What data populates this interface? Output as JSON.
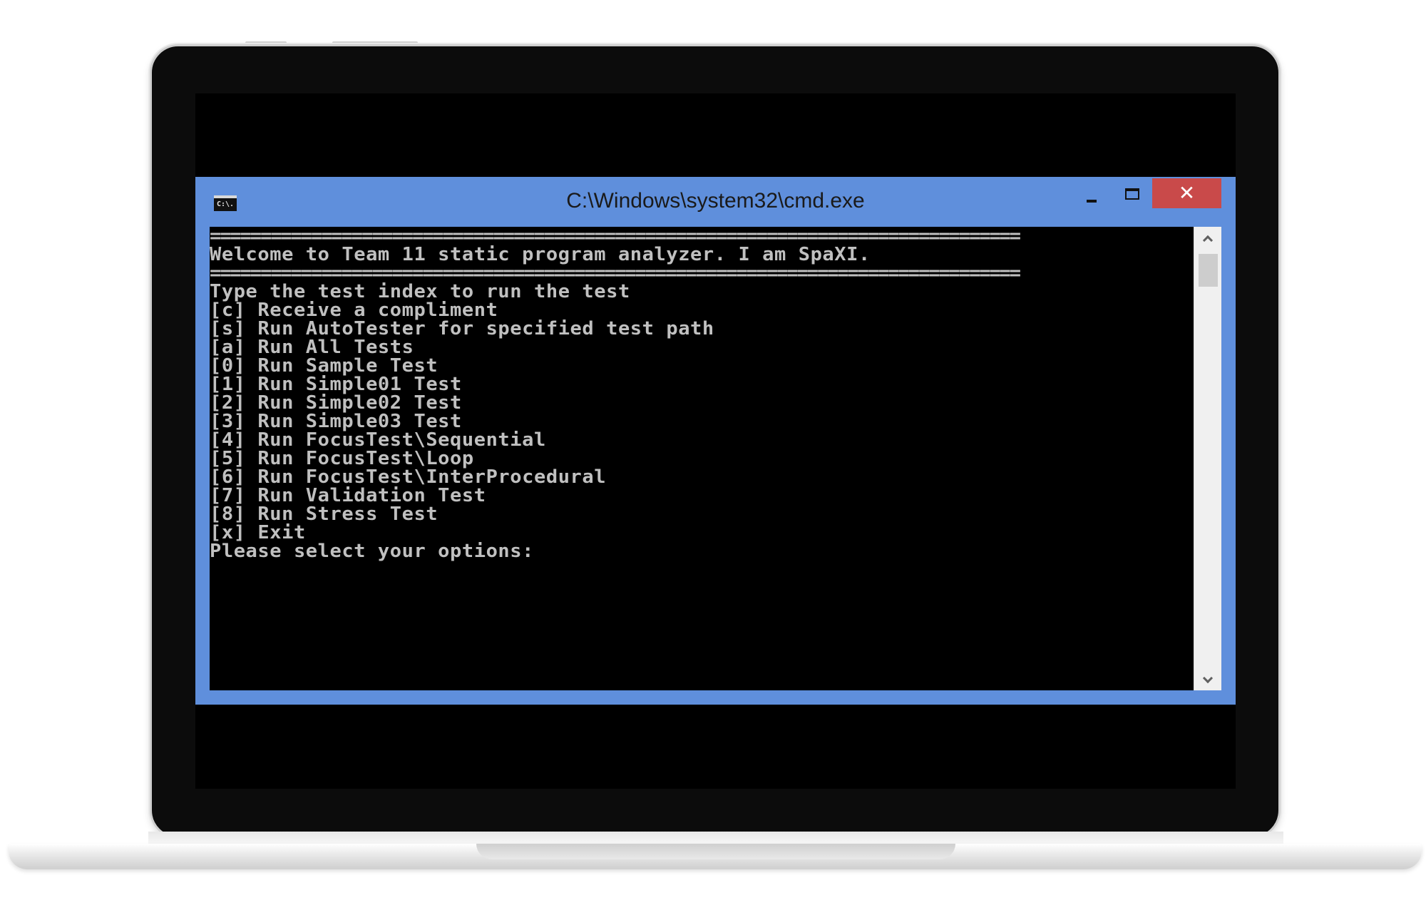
{
  "window": {
    "title": "C:\\Windows\\system32\\cmd.exe",
    "app_icon_text": "C:\\.",
    "close_symbol": "✕",
    "accent_color": "#5f8fdc",
    "close_color": "#c94a4a"
  },
  "console": {
    "lines": [
      "================================================================================",
      "Welcome to Team 11 static program analyzer. I am SpaXI.",
      "================================================================================",
      "Type the test index to run the test",
      "[c] Receive a compliment",
      "[s] Run AutoTester for specified test path",
      "[a] Run All Tests",
      "[0] Run Sample Test",
      "[1] Run Simple01 Test",
      "[2] Run Simple02 Test",
      "[3] Run Simple03 Test",
      "[4] Run FocusTest\\Sequential",
      "[5] Run FocusTest\\Loop",
      "[6] Run FocusTest\\InterProcedural",
      "[7] Run Validation Test",
      "[8] Run Stress Test",
      "[x] Exit",
      "Please select your options:"
    ],
    "text_color": "#c0c0c0",
    "background": "#000000"
  },
  "scrollbar": {
    "up_icon": "chevron-up-icon",
    "down_icon": "chevron-down-icon"
  }
}
